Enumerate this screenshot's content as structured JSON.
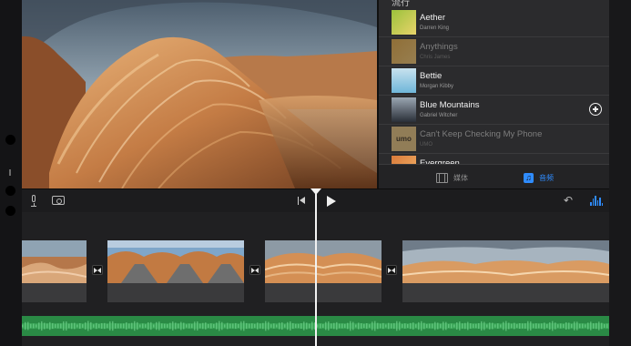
{
  "app": {
    "accent_color": "#2f8cff",
    "audio_track_color": "#2a8a45"
  },
  "browser": {
    "section_header": "流行",
    "songs": [
      {
        "title": "Aether",
        "artist": "Darren King",
        "thumb_colors": [
          "#9bc23c",
          "#e8d36a"
        ],
        "dimmed": false,
        "has_add": false
      },
      {
        "title": "Anythings",
        "artist": "Chris James",
        "thumb_colors": [
          "#e2a640",
          "#f0c36c"
        ],
        "dimmed": true,
        "has_add": false
      },
      {
        "title": "Bettie",
        "artist": "Morgan Kibby",
        "thumb_colors": [
          "#6fb6d9",
          "#c8e2ee"
        ],
        "dimmed": false,
        "has_add": false
      },
      {
        "title": "Blue Mountains",
        "artist": "Gabriel Witcher",
        "thumb_colors": [
          "#2a2f38",
          "#9aa6b2"
        ],
        "dimmed": false,
        "has_add": true
      },
      {
        "title": "Can't Keep Checking My Phone",
        "artist": "UMO",
        "thumb_colors": [
          "#e5c07b",
          "#3a2e1c"
        ],
        "thumb_text": "umo",
        "dimmed": true,
        "has_add": false
      },
      {
        "title": "Evergreen",
        "artist": "",
        "thumb_colors": [
          "#d97a3a",
          "#f2b46a"
        ],
        "dimmed": false,
        "has_add": false
      }
    ],
    "tabs": [
      {
        "label": "媒体",
        "icon": "film-icon",
        "active": false
      },
      {
        "label": "音频",
        "icon": "music-note-icon",
        "active": true
      }
    ]
  },
  "toolbar": {
    "icons": [
      "microphone-icon",
      "camera-icon",
      "skip-back-icon",
      "play-icon",
      "undo-icon",
      "audio-waveform-icon"
    ]
  },
  "timeline": {
    "clips": [
      "clip-1",
      "clip-2",
      "clip-3",
      "clip-4"
    ],
    "transitions": [
      "transition-1",
      "transition-2",
      "transition-3"
    ]
  }
}
